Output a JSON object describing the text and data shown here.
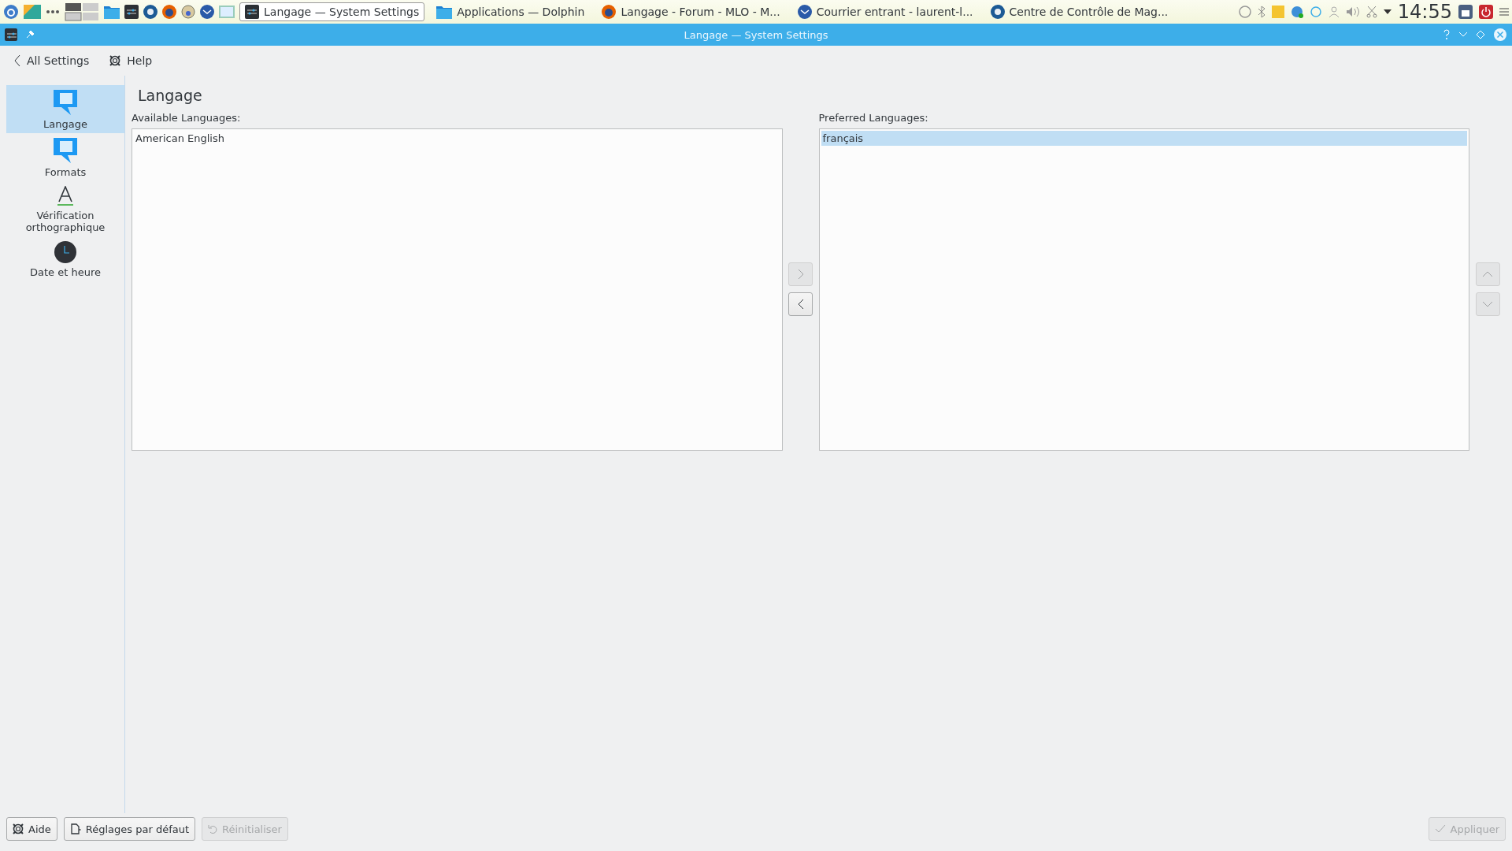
{
  "taskbar": {
    "tasks": [
      {
        "label": "Langage — System Settings",
        "kind": "settings",
        "selected": true
      },
      {
        "label": "Applications — Dolphin",
        "kind": "folder",
        "selected": false
      },
      {
        "label": "Langage - Forum - MLO - M...",
        "kind": "browser",
        "selected": false
      },
      {
        "label": "Courrier entrant - laurent-l...",
        "kind": "mail",
        "selected": false
      },
      {
        "label": "Centre de Contrôle de Mag...",
        "kind": "control",
        "selected": false
      }
    ],
    "clock": "14:55"
  },
  "window": {
    "title": "Langage — System Settings"
  },
  "toolbar": {
    "back": "All Settings",
    "help": "Help"
  },
  "sidebar": {
    "items": [
      {
        "label": "Langage",
        "kind": "bubble",
        "selected": true
      },
      {
        "label": "Formats",
        "kind": "bubble",
        "selected": false
      },
      {
        "label": "Vérification orthographique",
        "kind": "spell",
        "selected": false
      },
      {
        "label": "Date et heure",
        "kind": "clock",
        "selected": false
      }
    ]
  },
  "page": {
    "title": "Langage",
    "available": {
      "label": "Available Languages:",
      "items": [
        {
          "label": "American English",
          "selected": false
        }
      ]
    },
    "preferred": {
      "label": "Preferred Languages:",
      "items": [
        {
          "label": "français",
          "selected": true
        }
      ]
    },
    "move_buttons": [
      {
        "kind": "add",
        "disabled": true
      },
      {
        "kind": "remove",
        "disabled": false
      }
    ],
    "order_buttons": [
      {
        "kind": "up",
        "disabled": true
      },
      {
        "kind": "down",
        "disabled": true
      }
    ]
  },
  "footer": {
    "buttons": [
      {
        "label": "Aide",
        "kind": "help",
        "disabled": false
      },
      {
        "label": "Réglages par défaut",
        "kind": "defaults",
        "disabled": false
      },
      {
        "label": "Réinitialiser",
        "kind": "reset",
        "disabled": true
      },
      {
        "label": "Appliquer",
        "kind": "apply",
        "disabled": true
      }
    ]
  }
}
